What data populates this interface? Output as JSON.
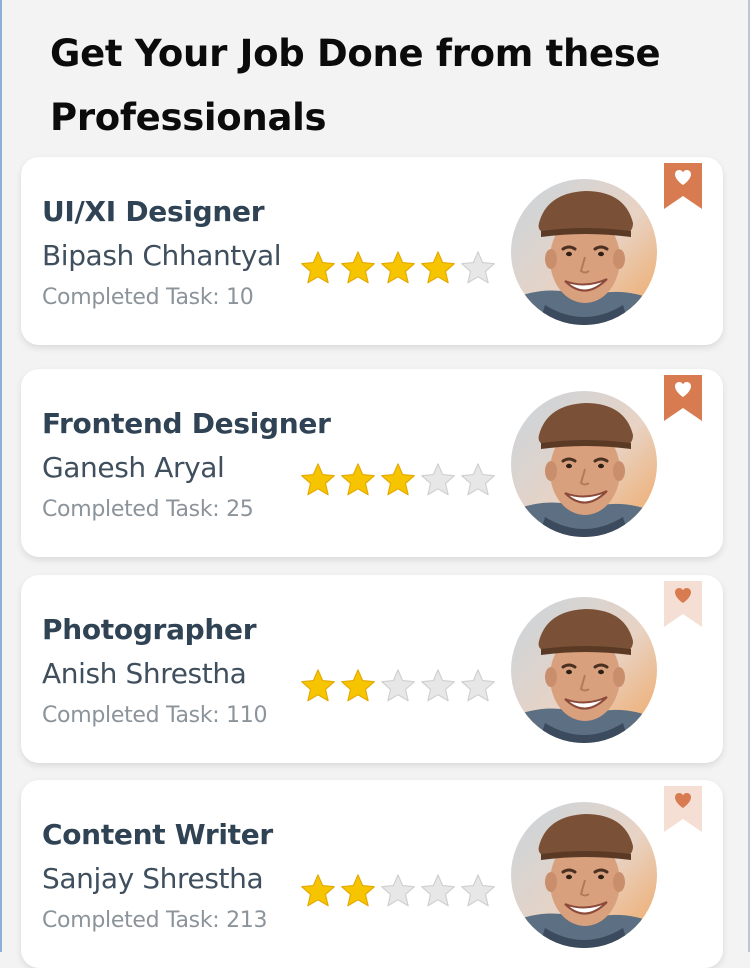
{
  "page": {
    "title": "Get Your Job Done from these Professionals"
  },
  "colors": {
    "background": "#f3f3f3",
    "card": "#ffffff",
    "role_text": "#2f4355",
    "name_text": "#3f4f5d",
    "task_text": "#8c949b",
    "star_filled": "#f7c400",
    "star_empty": "#e7e7e7",
    "bookmark_active": "#d97b50",
    "bookmark_inactive": "#f5dfd4",
    "heart_active": "#ffffff",
    "heart_inactive": "#d97b50"
  },
  "professionals": [
    {
      "role": "UI/XI Designer",
      "name": "Bipash Chhantyal",
      "tasks": "Completed Task: 10",
      "rating": 4,
      "rating_max": 5,
      "bookmarked": true,
      "bookmark_icon": "heart-bookmark-icon"
    },
    {
      "role": "Frontend Designer",
      "name": "Ganesh Aryal",
      "tasks": "Completed Task: 25",
      "rating": 3,
      "rating_max": 5,
      "bookmarked": true,
      "bookmark_icon": "heart-bookmark-icon"
    },
    {
      "role": "Photographer",
      "name": "Anish Shrestha",
      "tasks": "Completed Task: 110",
      "rating": 2,
      "rating_max": 5,
      "bookmarked": false,
      "bookmark_icon": "heart-bookmark-icon"
    },
    {
      "role": "Content Writer",
      "name": "Sanjay Shrestha",
      "tasks": "Completed Task: 213",
      "rating": 2,
      "rating_max": 5,
      "bookmarked": false,
      "bookmark_icon": "heart-bookmark-icon"
    }
  ]
}
